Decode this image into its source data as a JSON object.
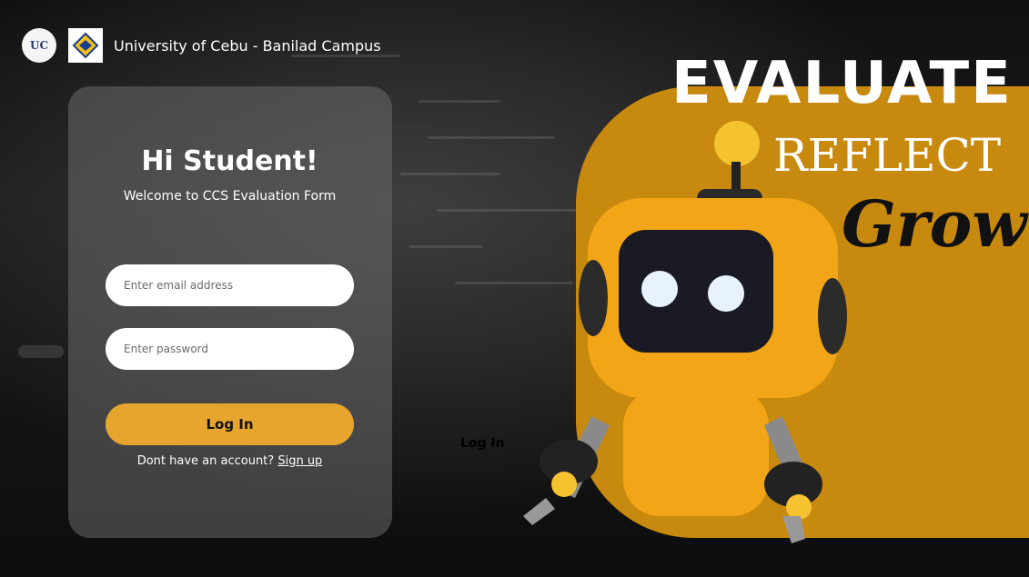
{
  "header": {
    "logo_text": "UC",
    "campus": "University of Cebu - Banilad Campus"
  },
  "card": {
    "greeting": "Hi Student!",
    "subtitle": "Welcome to CCS Evaluation Form",
    "email_placeholder": "Enter email address",
    "password_placeholder": "Enter password",
    "login_label": "Log In",
    "signup_prompt": "Dont have an account?",
    "signup_link": "Sign up"
  },
  "ghost_text": "Log In",
  "hero": {
    "word1": "EVALUATE",
    "word2": "REFLECT",
    "word3": "Grow"
  },
  "colors": {
    "accent": "#e7a52e",
    "panel": "#c8890f",
    "robot_body": "#f2a516"
  }
}
